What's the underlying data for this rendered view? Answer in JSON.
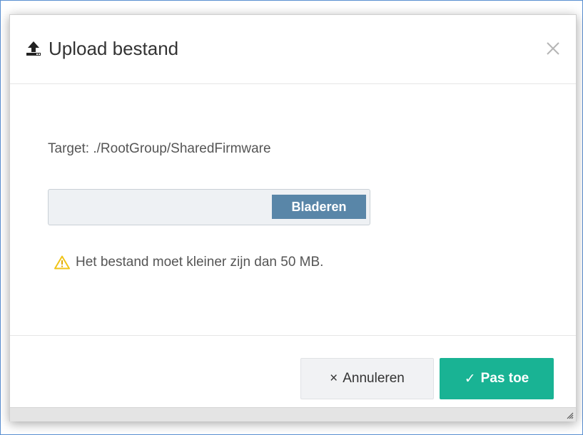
{
  "dialog": {
    "title": "Upload bestand",
    "title_icon": "upload-icon",
    "close_icon": "close-icon"
  },
  "body": {
    "target_text": "Target: ./RootGroup/SharedFirmware",
    "browse_label": "Bladeren",
    "warning_icon": "warning-icon",
    "warning_text": "Het bestand moet kleiner zijn dan 50 MB."
  },
  "footer": {
    "cancel_glyph": "×",
    "cancel_label": "Annuleren",
    "apply_glyph": "✓",
    "apply_label": "Pas toe"
  },
  "colors": {
    "apply_button": "#19b394",
    "browse_button": "#5986a8",
    "warning": "#f0c419"
  }
}
